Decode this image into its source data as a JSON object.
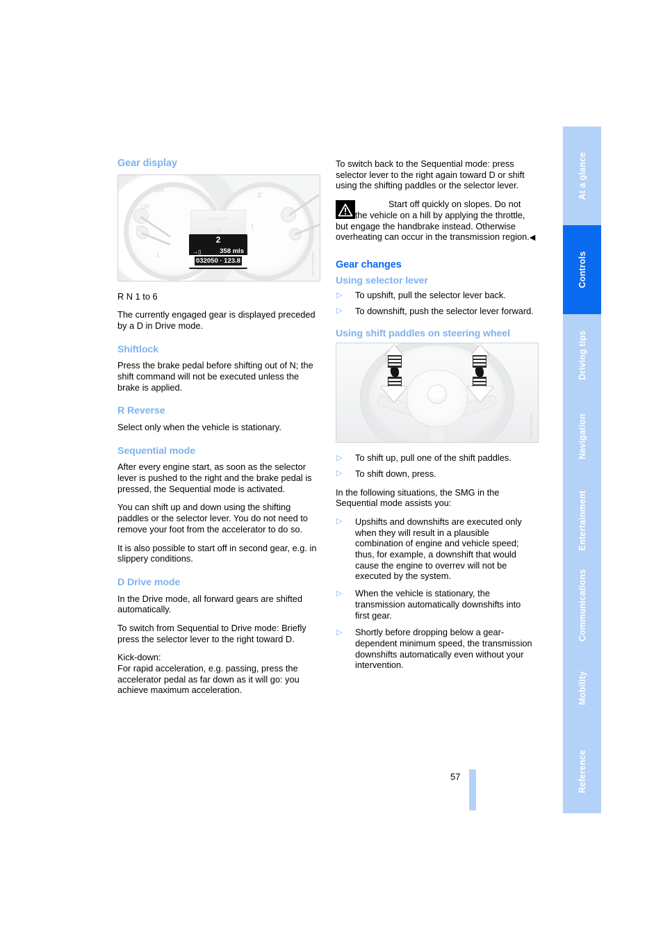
{
  "page": {
    "number": "57"
  },
  "sidebar": {
    "tabs": [
      {
        "label": "At a glance",
        "active": false
      },
      {
        "label": "Controls",
        "active": true
      },
      {
        "label": "Driving tips",
        "active": false
      },
      {
        "label": "Navigation",
        "active": false
      },
      {
        "label": "Entertainment",
        "active": false
      },
      {
        "label": "Communications",
        "active": false
      },
      {
        "label": "Mobility",
        "active": false
      },
      {
        "label": "Reference",
        "active": false
      }
    ],
    "colors": {
      "inactive": "#b4d2f7",
      "active": "#0a6af0",
      "label": "#ffffff"
    }
  },
  "colors": {
    "section_heading": "#0a6af0",
    "subsection_heading": "#7fb2ef",
    "bullet_marker": "#7fb2ef",
    "body_text": "#000000"
  },
  "left_column": {
    "gear_display": {
      "heading": "Gear display",
      "figure": {
        "name": "instrument-cluster-gear-display",
        "lcd": {
          "gear": "2",
          "range": "358 mls",
          "odometer": "032050 · 123.8",
          "fuel_icon": "→▯"
        },
        "dial_ticks_left": [
          "100",
          "120",
          "140",
          "1"
        ],
        "dial_ticks_right": [
          "2",
          "1"
        ],
        "upper_display": [
          "9:19 pm",
          "74"
        ],
        "credit": "www.bmw-sale"
      },
      "gear_list": "R N 1 to 6",
      "paragraph": "The currently engaged gear is displayed preceded by a D in Drive mode."
    },
    "shiftlock": {
      "heading": "Shiftlock",
      "paragraph": "Press the brake pedal before shifting out of N; the shift command will not be executed unless the brake is applied."
    },
    "reverse": {
      "heading": "R Reverse",
      "paragraph": "Select only when the vehicle is stationary."
    },
    "sequential_mode": {
      "heading": "Sequential mode",
      "paragraphs": [
        "After every engine start, as soon as the selector lever is pushed to the right and the brake pedal is pressed, the Sequential mode is activated.",
        "You can shift up and down using the shifting paddles or the selector lever. You do not need to remove your foot from the accelerator to do so.",
        "It is also possible to start off in second gear, e.g. in slippery conditions."
      ]
    },
    "drive_mode": {
      "heading": "D Drive mode",
      "paragraphs": [
        "In the Drive mode, all forward gears are shifted automatically.",
        "To switch from Sequential to Drive mode: Briefly press the selector lever to the right toward D.",
        "Kick-down:",
        "For rapid acceleration, e.g. passing, press the accelerator pedal as far down as it will go: you achieve maximum acceleration."
      ]
    }
  },
  "right_column": {
    "intro_paragraph": "To switch back to the Sequential mode: press selector lever to the right again toward D or shift using the shifting paddles or the selector lever.",
    "warning": {
      "icon": "warning-triangle-icon",
      "text": "Start off quickly on slopes. Do not hold the vehicle on a hill by applying the throttle, but engage the handbrake instead. Otherwise overheating can occur in the transmission region.",
      "end_mark": "◀"
    },
    "gear_changes": {
      "heading": "Gear changes",
      "using_selector_lever": {
        "heading": "Using selector lever",
        "bullets": [
          "To upshift, pull the selector lever back.",
          "To downshift, push the selector lever forward."
        ]
      },
      "using_shift_paddles": {
        "heading": "Using shift paddles on steering wheel",
        "figure": {
          "name": "steering-wheel-shift-paddles",
          "credit": "www.bmw-sale"
        },
        "bullets": [
          "To shift up, pull one of the shift paddles.",
          "To shift down, press."
        ],
        "intro": "In the following situations, the SMG in the Sequential mode assists you:",
        "assist_bullets": [
          "Upshifts and downshifts are executed only when they will result in a plausible combination of engine and vehicle speed; thus, for example, a downshift that would cause the engine to overrev will not be executed by the system.",
          "When the vehicle is stationary, the transmission automatically downshifts into first gear.",
          "Shortly before dropping below a gear-dependent minimum speed, the transmission downshifts automatically even without your intervention."
        ]
      }
    }
  }
}
